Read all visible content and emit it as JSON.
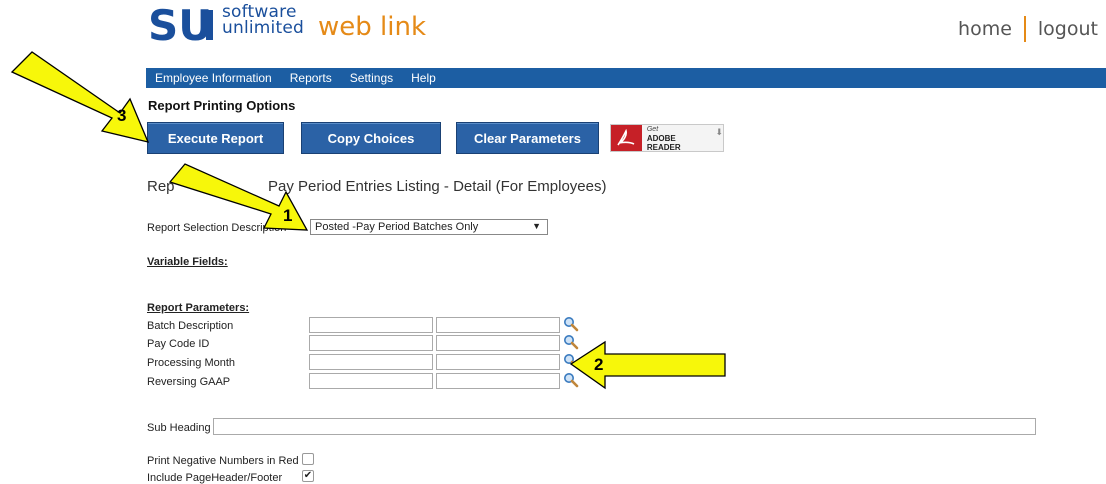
{
  "header": {
    "logo_line1": "software",
    "logo_line2": "unlimited",
    "app_name": "web link",
    "home_link": "home",
    "logout_link": "logout"
  },
  "nav": {
    "items": [
      "Employee Information",
      "Reports",
      "Settings",
      "Help"
    ]
  },
  "page": {
    "title": "Report Printing Options",
    "report_name_visible_left": "Rep",
    "report_name_visible_right": "Pay Period Entries Listing - Detail (For Employees)"
  },
  "toolbar": {
    "execute_label": "Execute Report",
    "copy_label": "Copy Choices",
    "clear_label": "Clear Parameters",
    "adobe_get": "Get",
    "adobe_name": "ADOBE READER"
  },
  "selection": {
    "label": "Report Selection Description",
    "value": "Posted -Pay Period Batches Only"
  },
  "sections": {
    "variable_fields": "Variable Fields:",
    "report_parameters": "Report Parameters:"
  },
  "parameters": [
    {
      "label": "Batch Description"
    },
    {
      "label": "Pay Code ID"
    },
    {
      "label": "Processing Month"
    },
    {
      "label": "Reversing GAAP"
    }
  ],
  "sub_heading": {
    "label": "Sub Heading",
    "value": ""
  },
  "options": [
    {
      "label": "Print Negative Numbers in Red",
      "checked": false
    },
    {
      "label": "Include PageHeader/Footer",
      "checked": true
    }
  ],
  "annotations": {
    "a1": "1",
    "a2": "2",
    "a3": "3",
    "color": "#f7f70a"
  }
}
